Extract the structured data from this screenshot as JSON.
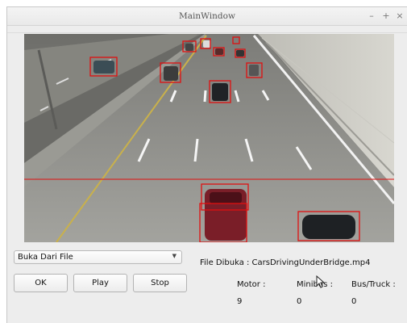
{
  "window": {
    "title": "MainWindow",
    "controls": [
      "–",
      "+",
      "×"
    ]
  },
  "controls": {
    "source_select": {
      "selected": "Buka Dari File"
    },
    "ok_label": "OK",
    "play_label": "Play",
    "stop_label": "Stop"
  },
  "file_info": {
    "opened_file": "File Dibuka : CarsDrivingUnderBridge.mp4"
  },
  "counts": {
    "motor_label": "Motor :",
    "motor_value": "9",
    "minibus_label": "Minibus :",
    "minibus_value": "0",
    "bustruck_label": "Bus/Truck :",
    "bustruck_value": "0"
  },
  "colors": {
    "detection_box": "#e01010",
    "counting_line": "#e01010"
  },
  "icons": {
    "combo_arrow": "chevron-down-icon",
    "cursor": "mouse-pointer-icon"
  }
}
